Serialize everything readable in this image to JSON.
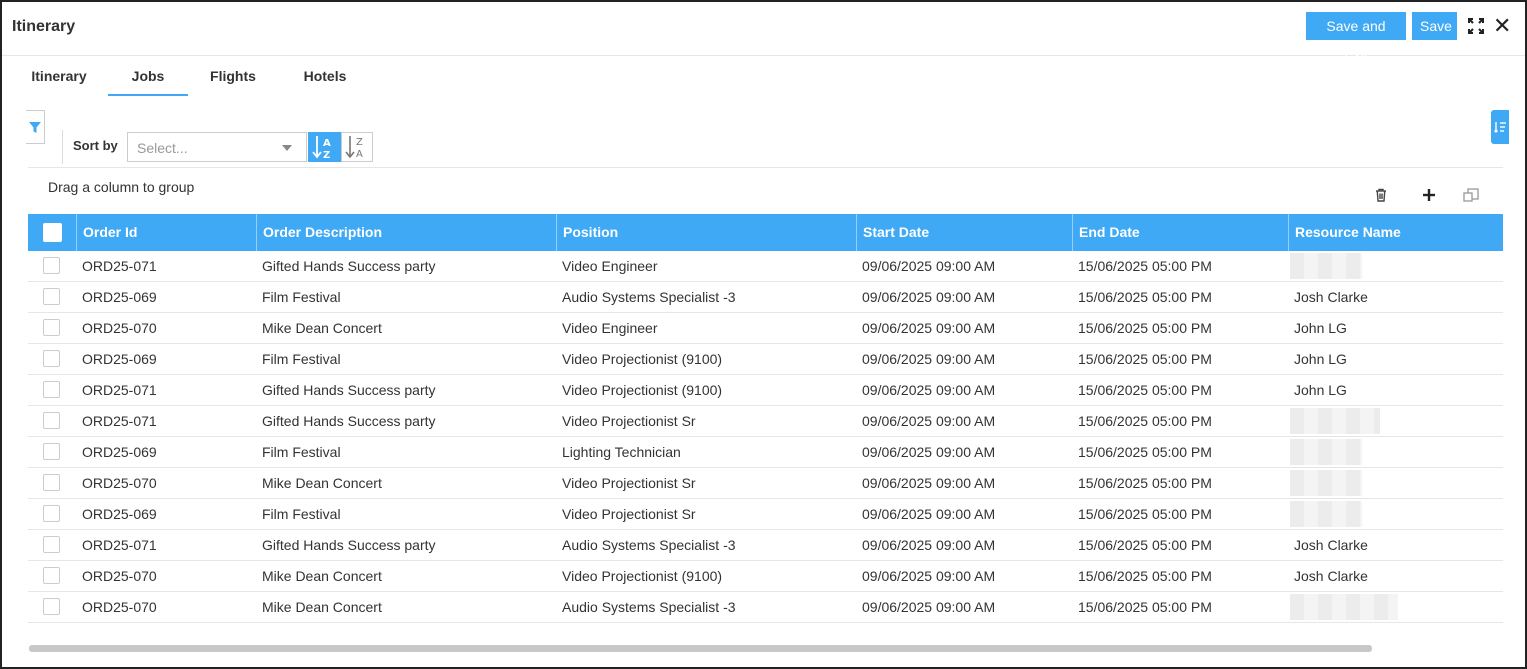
{
  "window": {
    "title": "Itinerary"
  },
  "header": {
    "save_exit_label": "Save and Exit",
    "save_label": "Save"
  },
  "tabs": [
    {
      "label": "Itinerary",
      "active": false
    },
    {
      "label": "Jobs",
      "active": true
    },
    {
      "label": "Flights",
      "active": false
    },
    {
      "label": "Hotels",
      "active": false
    }
  ],
  "sort": {
    "label": "Sort by",
    "placeholder": "Select..."
  },
  "grid": {
    "group_hint": "Drag a column to group",
    "columns": [
      "Order Id",
      "Order Description",
      "Position",
      "Start Date",
      "End Date",
      "Resource Name"
    ],
    "rows": [
      {
        "order_id": "ORD25-071",
        "description": "Gifted Hands Success party",
        "position": "Video Engineer",
        "start": "09/06/2025 09:00 AM",
        "end": "15/06/2025 05:00 PM",
        "resource": ""
      },
      {
        "order_id": "ORD25-069",
        "description": "Film Festival",
        "position": "Audio Systems Specialist -3",
        "start": "09/06/2025 09:00 AM",
        "end": "15/06/2025 05:00 PM",
        "resource": "Josh Clarke"
      },
      {
        "order_id": "ORD25-070",
        "description": "Mike Dean Concert",
        "position": "Video Engineer",
        "start": "09/06/2025 09:00 AM",
        "end": "15/06/2025 05:00 PM",
        "resource": "John LG"
      },
      {
        "order_id": "ORD25-069",
        "description": "Film Festival",
        "position": "Video Projectionist (9100)",
        "start": "09/06/2025 09:00 AM",
        "end": "15/06/2025 05:00 PM",
        "resource": "John LG"
      },
      {
        "order_id": "ORD25-071",
        "description": "Gifted Hands Success party",
        "position": "Video Projectionist (9100)",
        "start": "09/06/2025 09:00 AM",
        "end": "15/06/2025 05:00 PM",
        "resource": "John LG"
      },
      {
        "order_id": "ORD25-071",
        "description": "Gifted Hands Success party",
        "position": "Video Projectionist Sr",
        "start": "09/06/2025 09:00 AM",
        "end": "15/06/2025 05:00 PM",
        "resource": ""
      },
      {
        "order_id": "ORD25-069",
        "description": "Film Festival",
        "position": "Lighting Technician",
        "start": "09/06/2025 09:00 AM",
        "end": "15/06/2025 05:00 PM",
        "resource": ""
      },
      {
        "order_id": "ORD25-070",
        "description": "Mike Dean Concert",
        "position": "Video Projectionist Sr",
        "start": "09/06/2025 09:00 AM",
        "end": "15/06/2025 05:00 PM",
        "resource": ""
      },
      {
        "order_id": "ORD25-069",
        "description": "Film Festival",
        "position": "Video Projectionist Sr",
        "start": "09/06/2025 09:00 AM",
        "end": "15/06/2025 05:00 PM",
        "resource": ""
      },
      {
        "order_id": "ORD25-071",
        "description": "Gifted Hands Success party",
        "position": "Audio Systems Specialist -3",
        "start": "09/06/2025 09:00 AM",
        "end": "15/06/2025 05:00 PM",
        "resource": "Josh Clarke"
      },
      {
        "order_id": "ORD25-070",
        "description": "Mike Dean Concert",
        "position": "Video Projectionist (9100)",
        "start": "09/06/2025 09:00 AM",
        "end": "15/06/2025 05:00 PM",
        "resource": "Josh Clarke"
      },
      {
        "order_id": "ORD25-070",
        "description": "Mike Dean Concert",
        "position": "Audio Systems Specialist -3",
        "start": "09/06/2025 09:00 AM",
        "end": "15/06/2025 05:00 PM",
        "resource": ""
      }
    ]
  },
  "icons": {
    "expand": "expand-icon",
    "close": "close-icon",
    "filter": "filter-icon",
    "side_panel": "column-chooser-icon",
    "sort_asc": "sort-ascending-icon",
    "sort_desc": "sort-descending-icon",
    "delete": "trash-icon",
    "add": "plus-icon",
    "copy": "copy-icon"
  },
  "colors": {
    "accent": "#3fa9f5",
    "header_text": "#ffffff",
    "text": "#333333"
  }
}
